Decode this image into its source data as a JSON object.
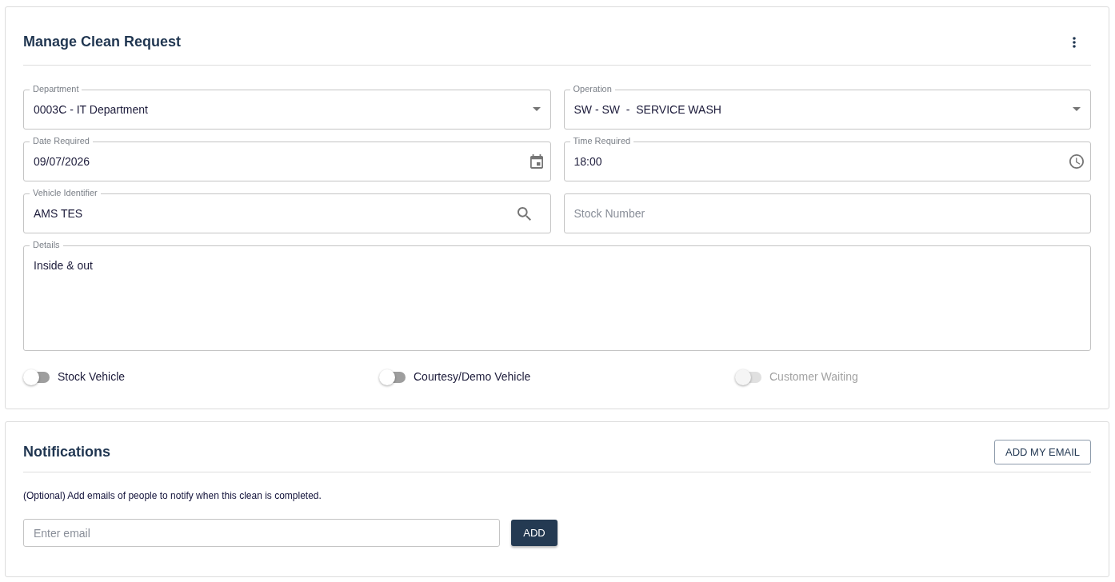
{
  "request": {
    "title": "Manage Clean Request",
    "fields": [
      {
        "kind": "select",
        "label": "Department",
        "value": "0003C - IT Department"
      },
      {
        "kind": "select",
        "label": "Operation",
        "value": "SW - SW  -  SERVICE WASH"
      },
      {
        "kind": "date",
        "label": "Date Required",
        "value": "09/07/2026"
      },
      {
        "kind": "time",
        "label": "Time Required",
        "value": "18:00"
      },
      {
        "kind": "search",
        "label": "Vehicle Identifier",
        "value": "AMS TES"
      },
      {
        "kind": "text",
        "placeholder": "Stock Number"
      },
      {
        "kind": "textarea",
        "label": "Details",
        "value": "Inside & out"
      }
    ],
    "toggles": [
      {
        "label": "Stock Vehicle",
        "on": false,
        "disabled": false
      },
      {
        "label": "Courtesy/Demo Vehicle",
        "on": false,
        "disabled": false
      },
      {
        "label": "Customer Waiting",
        "on": false,
        "disabled": true
      }
    ]
  },
  "notifications": {
    "title": "Notifications",
    "add_my_email_button": "ADD MY EMAIL",
    "hint": "(Optional) Add emails of people to notify when this clean is completed.",
    "email_field": {
      "placeholder": "Enter email"
    },
    "add_button": "ADD"
  }
}
